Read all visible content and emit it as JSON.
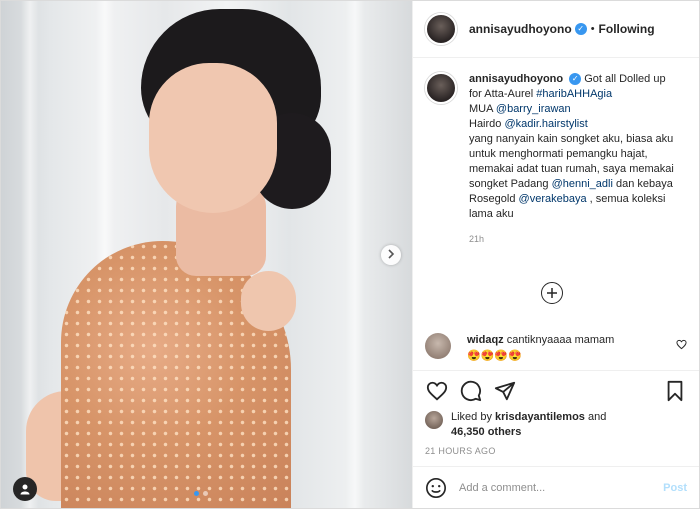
{
  "header": {
    "username": "annisayudhoyono",
    "separator": "•",
    "follow_state": "Following"
  },
  "caption": {
    "username": "annisayudhoyono",
    "part1": "Got all Dolled up for Atta-Aurel ",
    "hashtag": "#haribAHHAgia",
    "mua_label": "MUA ",
    "mua_link": "@barry_irawan",
    "hairdo_label": "Hairdo ",
    "hairdo_link": "@kadir.hairstylist",
    "body1": "yang nanyain kain songket aku, biasa aku untuk menghormati pemangku hajat, memakai adat tuan rumah, saya memakai songket Padang ",
    "link_henni": "@henni_adli",
    "body2": " dan kebaya Rosegold ",
    "link_vera": "@verakebaya",
    "body3": " , semua koleksi lama aku",
    "time": "21h"
  },
  "comment": {
    "username": "widaqz",
    "text": "cantiknyaaaa mamam",
    "emojis": "😍😍😍😍"
  },
  "likes": {
    "prefix": "Liked by ",
    "user": "krisdayantilemos",
    "middle": " and",
    "count": "46,350 others"
  },
  "timestamp": "21 HOURS AGO",
  "add_comment": {
    "placeholder": "Add a comment...",
    "post_label": "Post"
  },
  "icons": {
    "verified": "verified-badge-icon",
    "next": "chevron-right-icon",
    "tag": "user-tag-icon",
    "load": "plus-circle-icon",
    "like": "heart-icon",
    "comment": "comment-bubble-icon",
    "share": "paper-plane-icon",
    "save": "bookmark-icon",
    "emoji": "smiley-icon"
  },
  "colors": {
    "link": "#00376b",
    "verified": "#3897f0",
    "post_button": "#b2dffc"
  }
}
